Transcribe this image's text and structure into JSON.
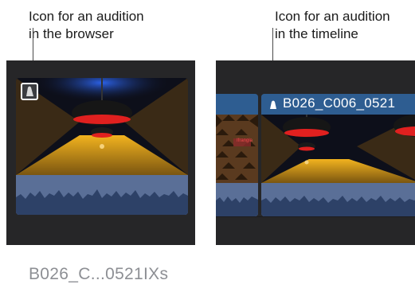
{
  "callouts": {
    "browser": {
      "line1": "Icon for an audition",
      "line2": "in the browser"
    },
    "timeline": {
      "line1": "Icon for an audition",
      "line2": "in the timeline"
    }
  },
  "browser": {
    "clip_name": "B026_C...0521IXs"
  },
  "timeline": {
    "clip_title": "B026_C006_0521",
    "neighbor_clip_label": "Ifrangia"
  },
  "colors": {
    "panel_bg": "#262628",
    "clip_header": "#2e5d91",
    "waveform_bg": "#5a6f97",
    "lamp_red": "#e0201f",
    "tunnel_blue": "#2f6bff",
    "floor_yellow": "#f2b31f"
  }
}
